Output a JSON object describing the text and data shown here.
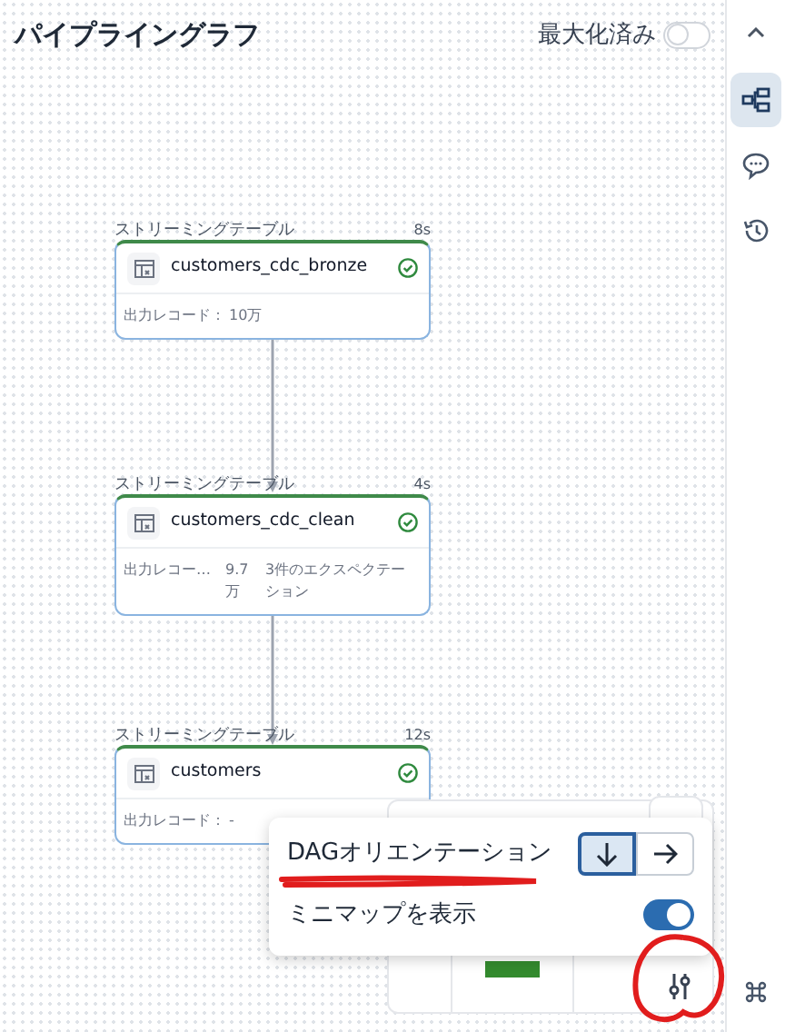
{
  "header": {
    "title": "パイプライングラフ",
    "maximize": {
      "label": "最大化済み",
      "on": false
    }
  },
  "rail": [
    {
      "kind": "graph",
      "selected": true
    },
    {
      "kind": "comment",
      "selected": false
    },
    {
      "kind": "history",
      "selected": false
    }
  ],
  "nodes": [
    {
      "type_label": "ストリーミングテーブル",
      "duration": "8s",
      "name": "customers_cdc_bronze",
      "completed": true,
      "metrics": [
        {
          "label": "出力レコード：",
          "value": "10万"
        }
      ]
    },
    {
      "type_label": "ストリーミングテーブル",
      "duration": "4s",
      "name": "customers_cdc_clean",
      "completed": true,
      "metrics": [
        {
          "label": "出力レコー…",
          "value": "9.7万"
        },
        {
          "label": "3件のエクスペクテーション"
        }
      ]
    },
    {
      "type_label": "ストリーミングテーブル",
      "duration": "12s",
      "name": "customers",
      "completed": true,
      "metrics": [
        {
          "label": "出力レコード：",
          "value": "-"
        }
      ]
    }
  ],
  "settings_popup": {
    "orientation": {
      "label": "DAGオリエンテーション",
      "options": [
        {
          "kind": "down",
          "selected": true
        },
        {
          "kind": "right",
          "selected": false
        }
      ]
    },
    "minimap": {
      "label": "ミニマップを表示",
      "on": true
    }
  }
}
